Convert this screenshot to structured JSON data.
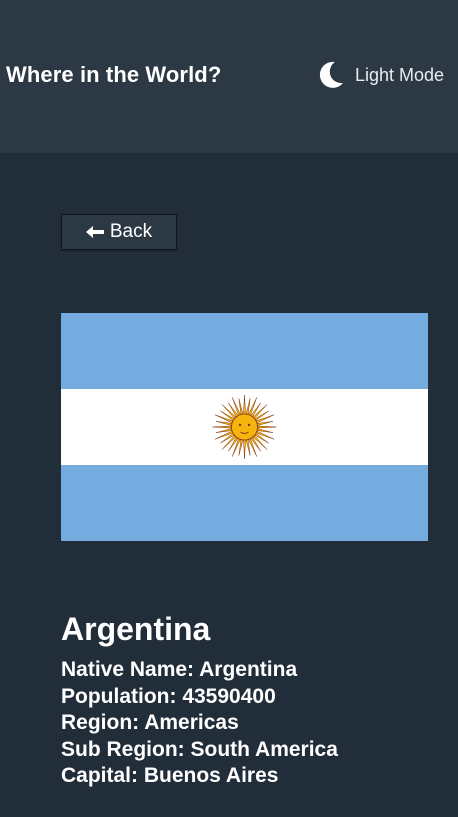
{
  "header": {
    "title": "Where in the World?",
    "theme_toggle_label": "Light Mode",
    "theme_icon": "moon-icon"
  },
  "back_button": {
    "label": "Back",
    "icon": "arrow-left-icon"
  },
  "country": {
    "name": "Argentina",
    "flag_colors": {
      "stripe": "#74acdf",
      "white": "#ffffff",
      "sun": "#f6b40e",
      "sun_outline": "#85340a"
    },
    "details": [
      {
        "label": "Native Name:",
        "value": "Argentina"
      },
      {
        "label": "Population:",
        "value": "43590400"
      },
      {
        "label": "Region:",
        "value": "Americas"
      },
      {
        "label": "Sub Region:",
        "value": "South America"
      },
      {
        "label": "Capital:",
        "value": "Buenos Aires"
      }
    ]
  },
  "colors": {
    "background": "#212e3a",
    "header": "#2c3945",
    "text": "#ffffff"
  }
}
